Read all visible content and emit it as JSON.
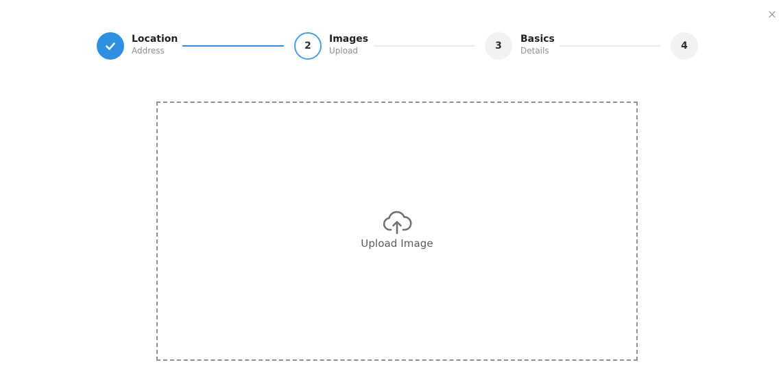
{
  "close": {
    "icon": "close-icon"
  },
  "steps": [
    {
      "title": "Location",
      "subtitle": "Address",
      "state": "done",
      "icon": "check-icon"
    },
    {
      "number": "2",
      "title": "Images",
      "subtitle": "Upload",
      "state": "active"
    },
    {
      "number": "3",
      "title": "Basics",
      "subtitle": "Details",
      "state": "pending"
    },
    {
      "number": "4",
      "state": "pending"
    }
  ],
  "upload": {
    "icon": "cloud-upload-icon",
    "label": "Upload Image"
  },
  "colors": {
    "accent": "#2f8fe0",
    "pending_circle": "#f1f2f4",
    "connector_inactive": "#e9eaec",
    "dashed_border": "#8f8f8f"
  }
}
